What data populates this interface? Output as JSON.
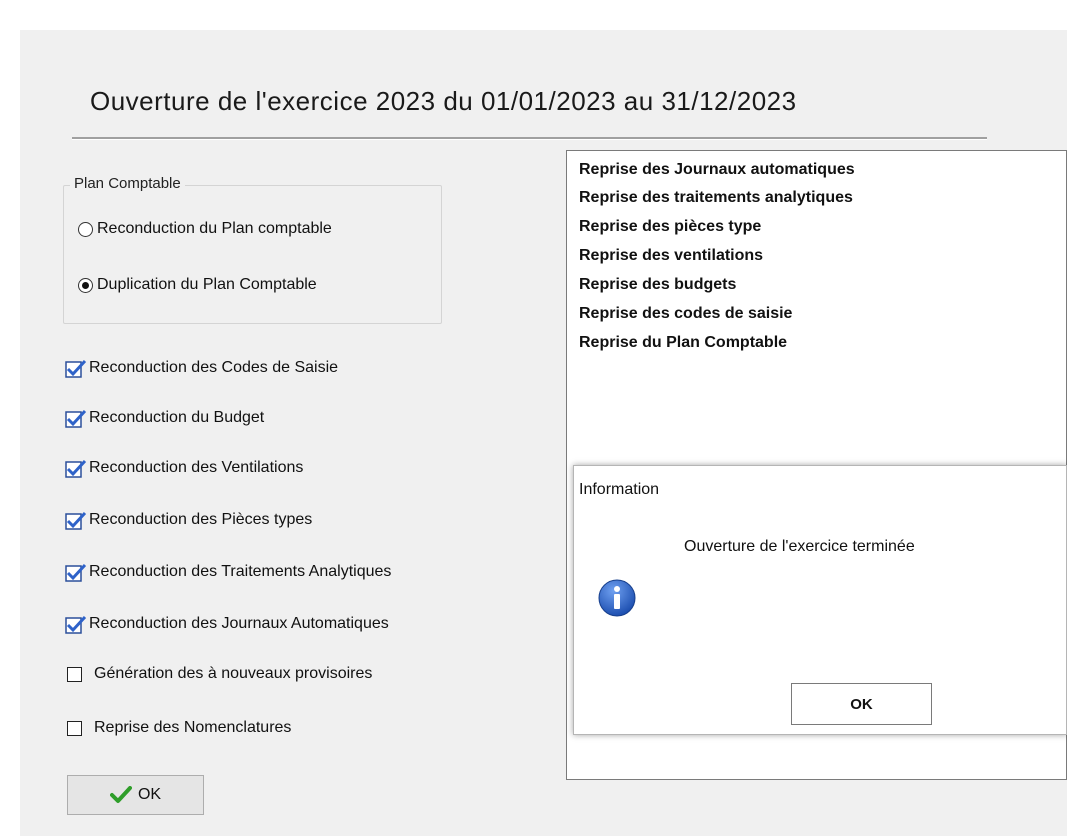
{
  "title": "Ouverture de l'exercice 2023 du 01/01/2023 au 31/12/2023",
  "plan_comptable": {
    "legend": "Plan Comptable",
    "options": [
      {
        "label": "Reconduction du Plan comptable",
        "selected": false
      },
      {
        "label": "Duplication du Plan Comptable",
        "selected": true
      }
    ]
  },
  "options": [
    {
      "label": "Reconduction des Codes de Saisie",
      "checked": true
    },
    {
      "label": "Reconduction du Budget",
      "checked": true
    },
    {
      "label": "Reconduction des Ventilations",
      "checked": true
    },
    {
      "label": "Reconduction des Pièces types",
      "checked": true
    },
    {
      "label": "Reconduction des Traitements Analytiques",
      "checked": true
    },
    {
      "label": "Reconduction des Journaux Automatiques",
      "checked": true
    },
    {
      "label": "Génération des à nouveaux provisoires",
      "checked": false
    },
    {
      "label": "Reprise des Nomenclatures",
      "checked": false
    }
  ],
  "ok_button": {
    "label": "OK",
    "icon": "checkmark-icon"
  },
  "log_lines": [
    "Reprise des Journaux automatiques",
    "Reprise des traitements analytiques",
    "Reprise des pièces type",
    "Reprise des ventilations",
    "Reprise des budgets",
    "Reprise des codes de saisie",
    "Reprise du Plan Comptable"
  ],
  "info_dialog": {
    "title": "Information",
    "message": "Ouverture de l'exercice terminée",
    "icon": "info-icon",
    "ok_label": "OK"
  },
  "colors": {
    "check_blue": "#2e62c9",
    "info_blue": "#2a5fc0",
    "window_bg": "#f0f0f0",
    "ok_check_green": "#2f9e2a"
  }
}
